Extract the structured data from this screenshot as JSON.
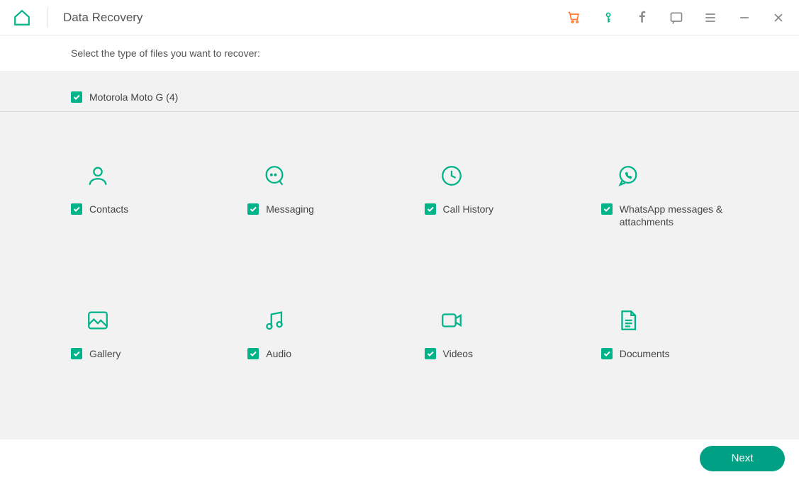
{
  "header": {
    "title": "Data Recovery"
  },
  "subheader": "Select the type of files you want to recover:",
  "device": {
    "name": "Motorola Moto G (4)",
    "checked": true
  },
  "categories": [
    {
      "id": "contacts",
      "label": "Contacts",
      "checked": true
    },
    {
      "id": "messaging",
      "label": "Messaging",
      "checked": true
    },
    {
      "id": "call-history",
      "label": "Call History",
      "checked": true
    },
    {
      "id": "whatsapp",
      "label": "WhatsApp messages & attachments",
      "checked": true
    },
    {
      "id": "gallery",
      "label": "Gallery",
      "checked": true
    },
    {
      "id": "audio",
      "label": "Audio",
      "checked": true
    },
    {
      "id": "videos",
      "label": "Videos",
      "checked": true
    },
    {
      "id": "documents",
      "label": "Documents",
      "checked": true
    }
  ],
  "footer": {
    "next_label": "Next"
  }
}
